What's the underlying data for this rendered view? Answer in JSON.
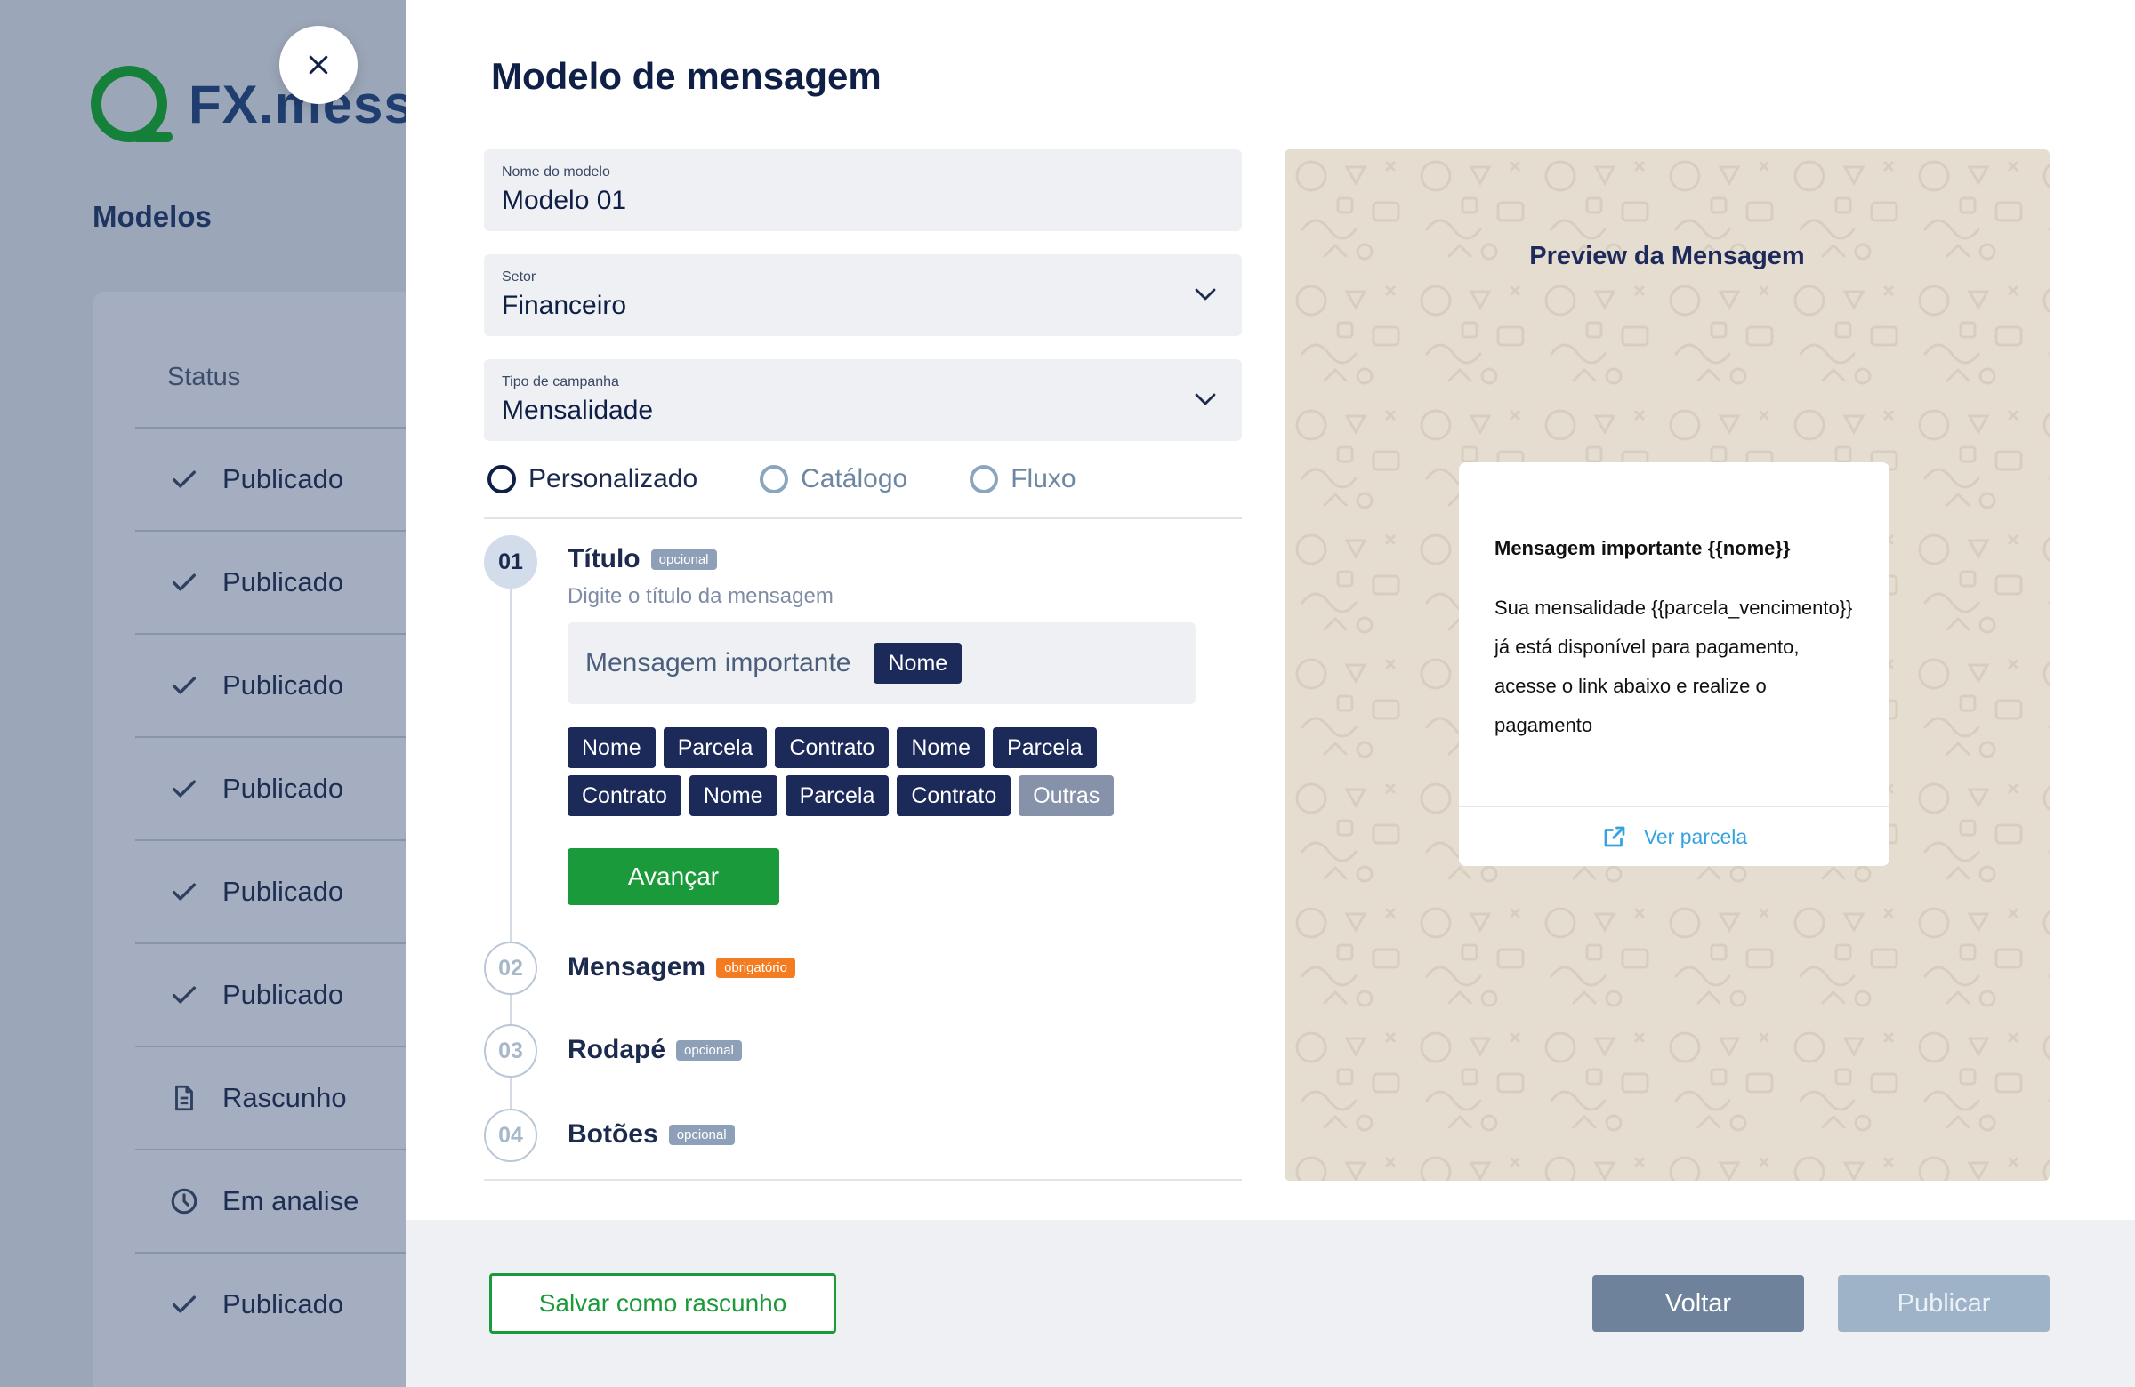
{
  "background": {
    "brand": "FX.mess",
    "section_title": "Modelos",
    "status_header": "Status",
    "rows": [
      {
        "icon": "check-icon",
        "label": "Publicado"
      },
      {
        "icon": "check-icon",
        "label": "Publicado"
      },
      {
        "icon": "check-icon",
        "label": "Publicado"
      },
      {
        "icon": "check-icon",
        "label": "Publicado"
      },
      {
        "icon": "check-icon",
        "label": "Publicado"
      },
      {
        "icon": "check-icon",
        "label": "Publicado"
      },
      {
        "icon": "document-icon",
        "label": "Rascunho"
      },
      {
        "icon": "clock-icon",
        "label": "Em analise"
      },
      {
        "icon": "check-icon",
        "label": "Publicado"
      }
    ]
  },
  "modal": {
    "title": "Modelo de mensagem",
    "fields": {
      "name": {
        "label": "Nome do modelo",
        "value": "Modelo 01"
      },
      "sector": {
        "label": "Setor",
        "value": "Financeiro"
      },
      "campaign": {
        "label": "Tipo de campanha",
        "value": "Mensalidade"
      }
    },
    "radios": [
      {
        "label": "Personalizado",
        "selected": true
      },
      {
        "label": "Catálogo",
        "selected": false
      },
      {
        "label": "Fluxo",
        "selected": false
      }
    ],
    "steps": [
      {
        "number": "01",
        "title": "Título",
        "badge": "opcional",
        "active": true
      },
      {
        "number": "02",
        "title": "Mensagem",
        "badge": "obrigatório",
        "active": false
      },
      {
        "number": "03",
        "title": "Rodapé",
        "badge": "opcional",
        "active": false
      },
      {
        "number": "04",
        "title": "Botões",
        "badge": "opcional",
        "active": false
      }
    ],
    "title_step": {
      "hint": "Digite o título da mensagem",
      "input_text": "Mensagem importante",
      "input_chip": "Nome",
      "chips": [
        "Nome",
        "Parcela",
        "Contrato",
        "Nome",
        "Parcela",
        "Contrato",
        "Nome",
        "Parcela",
        "Contrato",
        "Outras"
      ],
      "advance_label": "Avançar"
    }
  },
  "preview": {
    "title": "Preview da Mensagem",
    "heading": "Mensagem importante {{nome}}",
    "body": "Sua mensalidade {{parcela_vencimento}} já está disponível para pagamento, acesse o link abaixo e realize o pagamento",
    "link_label": "Ver parcela"
  },
  "footer": {
    "draft_label": "Salvar como rascunho",
    "back_label": "Voltar",
    "publish_label": "Publicar"
  },
  "colors": {
    "primary_green": "#1a9a3a",
    "navy": "#1c2a5a",
    "badge_orange": "#f47b20",
    "link_blue": "#35a2e0"
  }
}
